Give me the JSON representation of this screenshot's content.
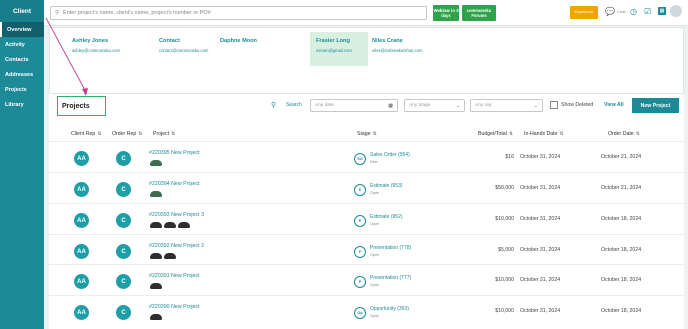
{
  "sidebar": {
    "title": "Client",
    "items": [
      {
        "label": "Overview"
      },
      {
        "label": "Activity"
      },
      {
        "label": "Contacts"
      },
      {
        "label": "Addresses"
      },
      {
        "label": "Projects"
      },
      {
        "label": "Library"
      }
    ]
  },
  "search": {
    "placeholder": "Enter project's name, client's name, project's number or PO#"
  },
  "topbar": {
    "webinar_label": "Webinar in 3 days",
    "community_label": "commonsku Forums",
    "orange_label": "Experience",
    "chat_label": "Chat"
  },
  "contacts": [
    {
      "name": "Ashley Jones",
      "email": "ashley@commonsku.com"
    },
    {
      "name": "Contact",
      "email": "contact@commonsku.com"
    },
    {
      "name": "Daphne Moon",
      "email": ""
    },
    {
      "name": "Frasier Long",
      "email": "icream@gmail.com"
    },
    {
      "name": "Niles Crane",
      "email": "niles@icebreakershop.com"
    }
  ],
  "projects": {
    "title": "Projects",
    "search_label": "Search",
    "date_placeholder": "Any date",
    "stage_placeholder": "Any stage",
    "rep_placeholder": "Any rep",
    "show_deleted_label": "Show Deleted",
    "view_all_label": "View All",
    "new_project_label": "New Project",
    "columns": {
      "client_rep": "Client Rep",
      "order_rep": "Order Rep",
      "project": "Project",
      "stage": "Stage",
      "budget": "Budget/Total",
      "in_hands": "In-Hands Date",
      "order_date": "Order Date"
    },
    "rows": [
      {
        "client_rep": "AA",
        "order_rep": "C",
        "name": "#220395 New Project",
        "stage_icon": "SO",
        "stage": "Sales Order (954)",
        "status": "New",
        "budget": "$16",
        "in_hands": "October 31, 2024",
        "order_date": "October 21, 2024"
      },
      {
        "client_rep": "AA",
        "order_rep": "C",
        "name": "#220394 New Project",
        "stage_icon": "E",
        "stage": "Estimate (953)",
        "status": "Open",
        "budget": "$50,000",
        "in_hands": "October 31, 2024",
        "order_date": "October 21, 2024"
      },
      {
        "client_rep": "AA",
        "order_rep": "C",
        "name": "#220393 New Project 3",
        "stage_icon": "E",
        "stage": "Estimate (952)",
        "status": "Open",
        "budget": "$10,000",
        "in_hands": "October 31, 2024",
        "order_date": "October 18, 2024"
      },
      {
        "client_rep": "AA",
        "order_rep": "C",
        "name": "#220392 New Project 2",
        "stage_icon": "P",
        "stage": "Presentation (778)",
        "status": "Open",
        "budget": "$5,000",
        "in_hands": "October 31, 2024",
        "order_date": "October 18, 2024"
      },
      {
        "client_rep": "AA",
        "order_rep": "C",
        "name": "#220391 New Project",
        "stage_icon": "P",
        "stage": "Presentation (777)",
        "status": "Open",
        "budget": "$10,000",
        "in_hands": "October 31, 2024",
        "order_date": "October 18, 2024"
      },
      {
        "client_rep": "AA",
        "order_rep": "C",
        "name": "#220390 New Project",
        "stage_icon": "Op",
        "stage": "Opportunity (393)",
        "status": "Open",
        "budget": "$10,000",
        "in_hands": "October 31, 2024",
        "order_date": "October 18, 2024"
      }
    ]
  },
  "colors": {
    "teal": "#1d8a98",
    "green": "#2fa24a",
    "orange": "#f2a400",
    "arrow": "#c2408f"
  }
}
